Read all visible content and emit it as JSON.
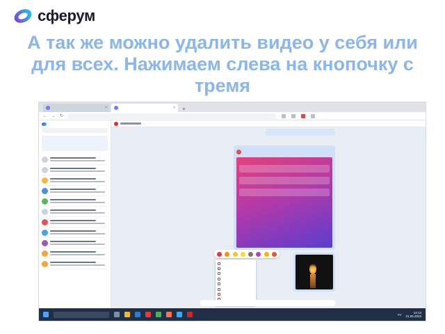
{
  "brand": {
    "name": "сферум",
    "logo_colors": [
      "#7b3fe4",
      "#1fc6e6"
    ]
  },
  "slide": {
    "heading": "А так же можно удалить видео у себя или для всех. Нажимаем слева на кнопочку с тремя",
    "heading_color": "#8bb6ec"
  },
  "colors": {
    "taskbar": "#1f2f45",
    "poll_gradient": [
      "#e0437d",
      "#b23aa8",
      "#5b3ccf"
    ],
    "danger": "#dd3333"
  },
  "taskbar": {
    "lang": "РУ",
    "time": "14:13",
    "date": "21.05.2023"
  }
}
